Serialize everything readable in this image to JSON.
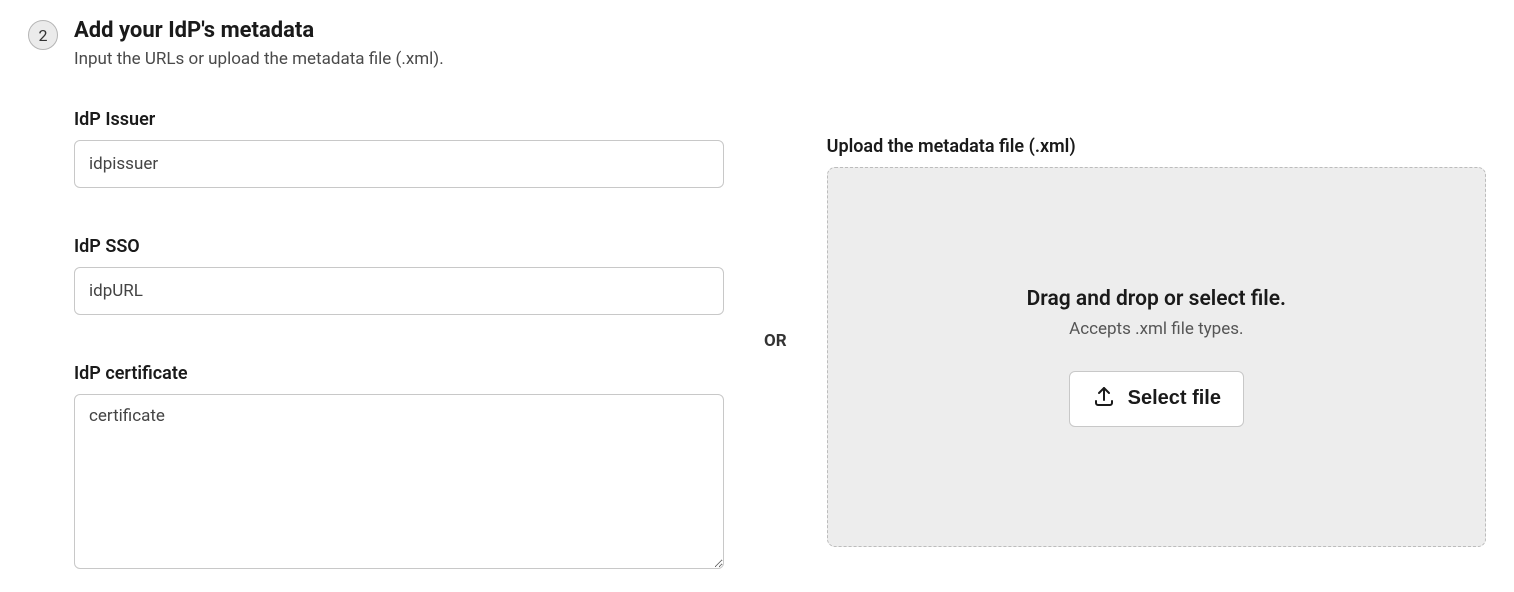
{
  "step": {
    "number": "2",
    "title": "Add your IdP's metadata",
    "description": "Input the URLs or upload the metadata file (.xml)."
  },
  "fields": {
    "issuer_label": "IdP Issuer",
    "issuer_value": "idpissuer",
    "sso_label": "IdP SSO",
    "sso_value": "idpURL",
    "cert_label": "IdP certificate",
    "cert_value": "certificate"
  },
  "divider": {
    "or_label": "OR"
  },
  "upload": {
    "label": "Upload the metadata file (.xml)",
    "drop_title": "Drag and drop or select file.",
    "drop_desc": "Accepts .xml file types.",
    "select_button": "Select file"
  }
}
